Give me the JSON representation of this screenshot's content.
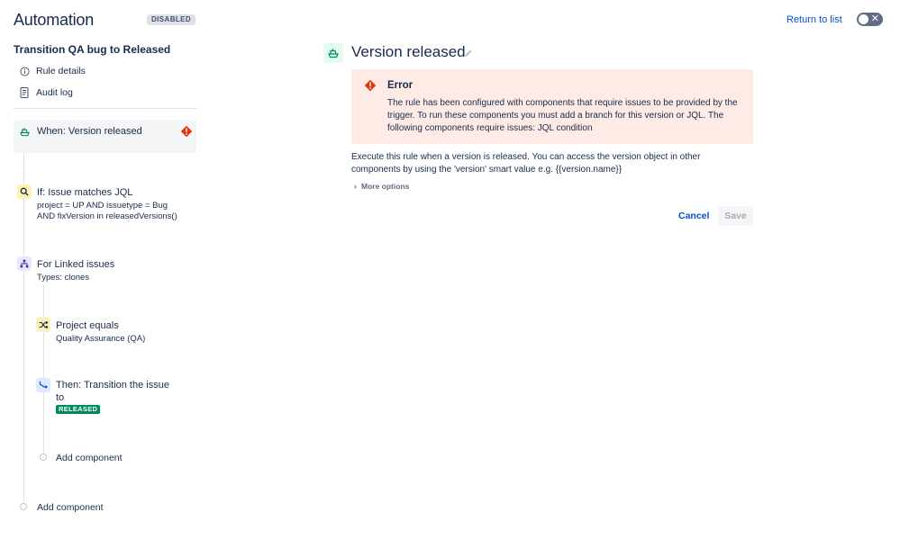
{
  "header": {
    "app_title": "Automation",
    "status_badge": "DISABLED",
    "return_link": "Return to list",
    "toggle_icon": "x-icon"
  },
  "sidebar": {
    "rule_name": "Transition QA bug to Released",
    "nav": [
      {
        "label": "Rule details",
        "icon": "info-icon"
      },
      {
        "label": "Audit log",
        "icon": "document-icon"
      }
    ]
  },
  "components": {
    "trigger": {
      "title": "When: Version released",
      "icon": "ship-icon",
      "status_icon": "error-icon"
    },
    "condition": {
      "title": "If: Issue matches JQL",
      "subtitle_line1": "project = UP AND issuetype = Bug",
      "subtitle_line2": "AND fixVersion in releasedVersions()",
      "icon": "search-icon"
    },
    "branch": {
      "title": "For Linked issues",
      "subtitle": "Types: clones",
      "icon": "branch-icon"
    },
    "branch_condition": {
      "title": "Project equals",
      "subtitle": "Quality Assurance (QA)",
      "icon": "shuffle-icon"
    },
    "action": {
      "title_line1": "Then: Transition the issue",
      "title_line2": "to",
      "lozenge": "RELEASED",
      "icon": "transition-icon"
    },
    "add_inner": "Add component",
    "add_outer": "Add component"
  },
  "panel": {
    "title": "Version released",
    "error": {
      "title": "Error",
      "message": "The rule has been configured with components that require issues to be provided by the trigger. To run these components you must add a branch for this version or JQL. The following components require issues: JQL condition"
    },
    "description": "Execute this rule when a version is released. You can access the version object in other components by using the 'version' smart value e.g. {{version.name}}",
    "more_options": "More options",
    "cancel_label": "Cancel",
    "save_label": "Save"
  },
  "colors": {
    "link": "#0052cc",
    "error_bg": "#ffebe6",
    "error_icon": "#de350b",
    "released": "#00875a",
    "trigger_icon": "#00875a",
    "condition_icon_bg": "#fff0b3",
    "branch_icon_bg": "#eae6ff",
    "action_icon_bg": "#deebff"
  }
}
